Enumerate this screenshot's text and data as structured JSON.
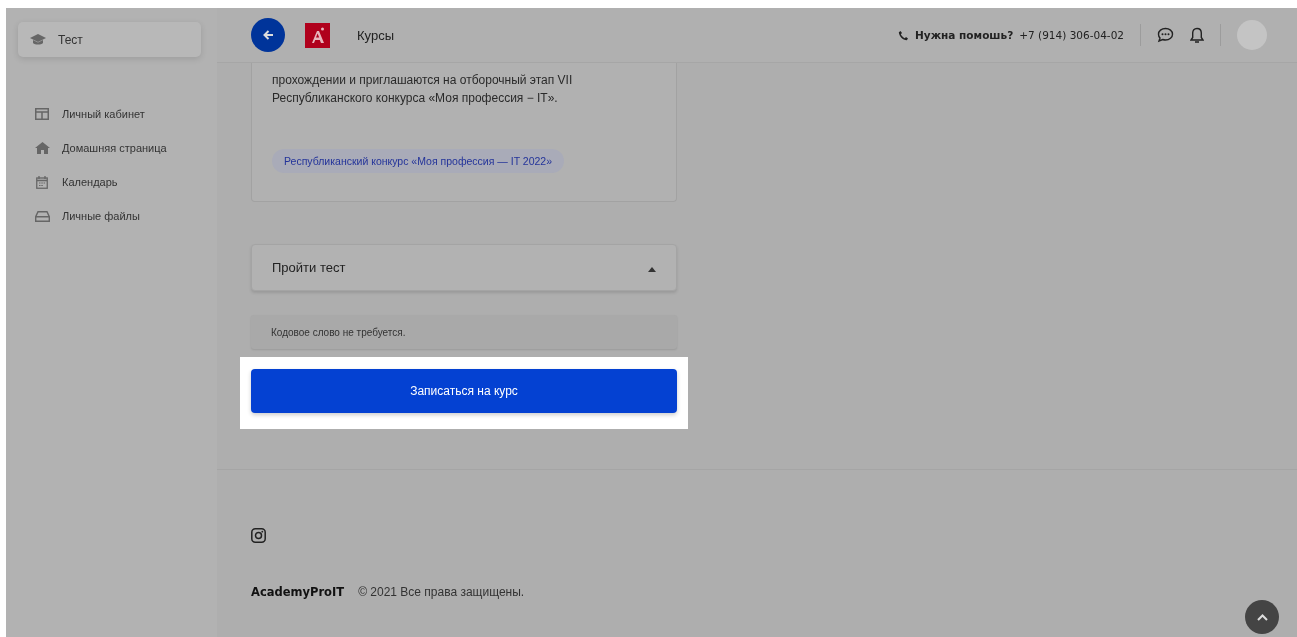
{
  "sidebar": {
    "course": "Тест",
    "items": [
      {
        "label": "Личный кабинет"
      },
      {
        "label": "Домашняя страница"
      },
      {
        "label": "Календарь"
      },
      {
        "label": "Личные файлы"
      }
    ]
  },
  "header": {
    "title": "Курсы",
    "help_label": "Нужна помошь?",
    "phone": "+7 (914) 306-04-02"
  },
  "content": {
    "description": "прохождении и приглашаются на отборочный этап VII\nРеспубликанского конкурса «Моя профессия − IT».",
    "tag": "Республиканский конкурс «Моя профессия — IT 2022»",
    "accordion": {
      "title": "Пройти тест",
      "expanded": true
    },
    "notice": "Кодовое слово не требуется.",
    "enroll_button": "Записаться на курс"
  },
  "footer": {
    "brand": "AcademyProIT",
    "copyright": "© 2021 Все права защищены."
  }
}
